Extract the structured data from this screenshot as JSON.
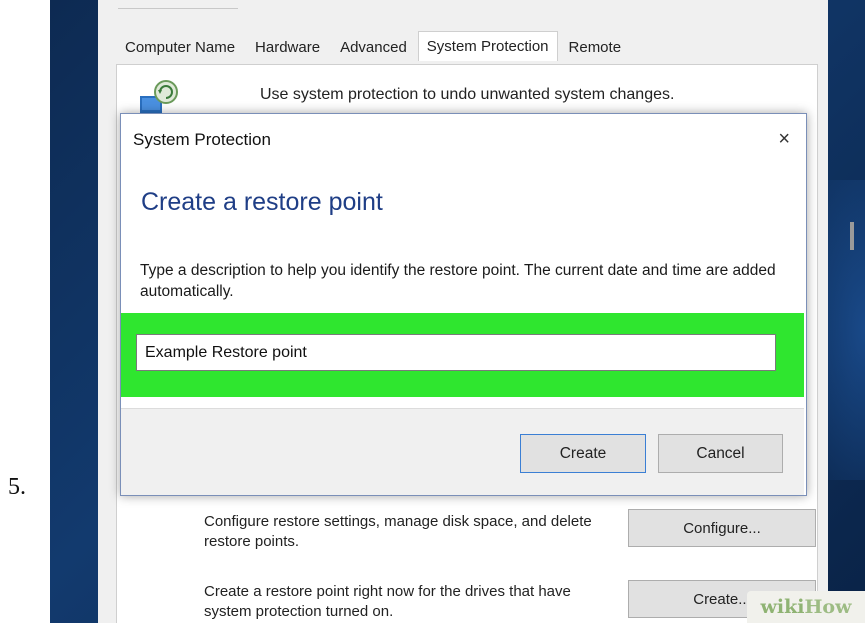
{
  "step_number": "5.",
  "system_properties": {
    "tabs": [
      {
        "label": "Computer Name",
        "active": false
      },
      {
        "label": "Hardware",
        "active": false
      },
      {
        "label": "Advanced",
        "active": false
      },
      {
        "label": "System Protection",
        "active": true
      },
      {
        "label": "Remote",
        "active": false
      }
    ],
    "intro_text": "Use system protection to undo unwanted system changes.",
    "configure_text": "Configure restore settings, manage disk space, and delete restore points.",
    "configure_button": "Configure...",
    "create_text": "Create a restore point right now for the drives that have system protection turned on.",
    "create_button": "Create..."
  },
  "dialog": {
    "title": "System Protection",
    "close_glyph": "×",
    "heading": "Create a restore point",
    "description": "Type a description to help you identify the restore point. The current date and time are added automatically.",
    "input_value": "Example Restore point",
    "create_label": "Create",
    "cancel_label": "Cancel"
  },
  "watermark": {
    "part1": "wiki",
    "part2": "How"
  },
  "colors": {
    "highlight": "#2fe62f",
    "heading": "#1f3e86",
    "desktop": "#123a6e"
  }
}
